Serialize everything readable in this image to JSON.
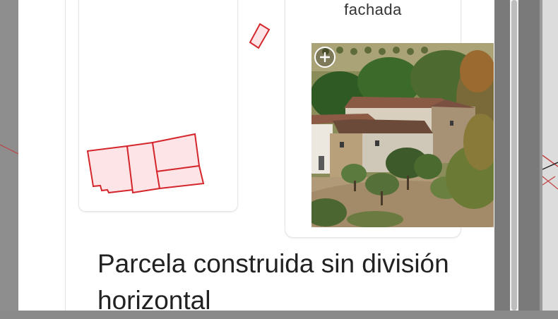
{
  "photo": {
    "caption": "fachada",
    "zoom_icon": "zoom-in-icon"
  },
  "plan": {
    "outline_color": "#d4262c",
    "fill_color": "#fde4e6"
  },
  "parcel": {
    "title": "Parcela construida sin división horizontal"
  }
}
